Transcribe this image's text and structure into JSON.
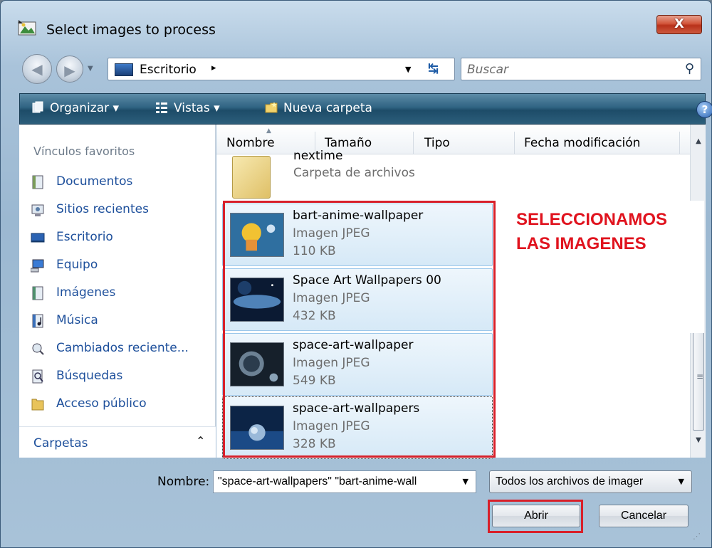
{
  "window": {
    "title": "Select images to process",
    "close_label": "X"
  },
  "address": {
    "location": "Escritorio",
    "separator": "▸",
    "search_placeholder": "Buscar"
  },
  "toolbar": {
    "organize": "Organizar ▾",
    "views": "Vistas ▾",
    "new_folder": "Nueva carpeta",
    "help": "?"
  },
  "sidebar": {
    "heading": "Vínculos favoritos",
    "items": [
      {
        "label": "Documentos",
        "icon": "documents-icon"
      },
      {
        "label": "Sitios recientes",
        "icon": "recent-places-icon"
      },
      {
        "label": "Escritorio",
        "icon": "desktop-icon"
      },
      {
        "label": "Equipo",
        "icon": "computer-icon"
      },
      {
        "label": "Imágenes",
        "icon": "pictures-icon"
      },
      {
        "label": "Música",
        "icon": "music-icon"
      },
      {
        "label": "Cambiados reciente...",
        "icon": "recently-changed-icon"
      },
      {
        "label": "Búsquedas",
        "icon": "searches-icon"
      },
      {
        "label": "Acceso público",
        "icon": "public-folder-icon"
      }
    ],
    "folders_label": "Carpetas"
  },
  "columns": [
    "Nombre",
    "Tamaño",
    "Tipo",
    "Fecha modificación"
  ],
  "folder_item": {
    "name": "nextime",
    "type": "Carpeta de archivos"
  },
  "files": [
    {
      "name": "bart-anime-wallpaper",
      "type": "Imagen JPEG",
      "size": "110 KB"
    },
    {
      "name": "Space Art Wallpapers 00",
      "type": "Imagen JPEG",
      "size": "432 KB"
    },
    {
      "name": "space-art-wallpaper",
      "type": "Imagen JPEG",
      "size": "549 KB"
    },
    {
      "name": "space-art-wallpapers",
      "type": "Imagen JPEG",
      "size": "328 KB"
    }
  ],
  "annotation": {
    "line1": "SELECCIONAMOS",
    "line2": "LAS IMAGENES"
  },
  "bottom": {
    "filename_label": "Nombre:",
    "filename_value": "\"space-art-wallpapers\" \"bart-anime-wall",
    "filter_value": "Todos los archivos de imager",
    "open_button": "Abrir",
    "cancel_button": "Cancelar"
  },
  "colors": {
    "highlight_red": "#d8202a",
    "annotation_red": "#e0131e",
    "link_blue": "#1d4f9b",
    "toolbar_teal": "#2f6382"
  }
}
